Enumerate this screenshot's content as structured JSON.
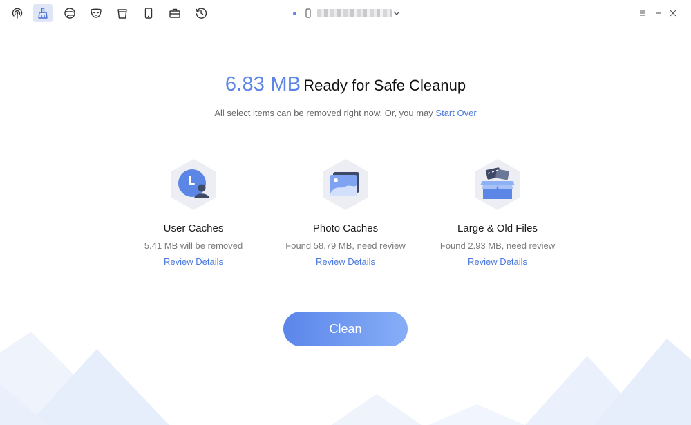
{
  "toolbar": {
    "tools": [
      {
        "icon": "airdrop-icon",
        "active": false
      },
      {
        "icon": "broom-icon",
        "active": true
      },
      {
        "icon": "browser-icon",
        "active": false
      },
      {
        "icon": "mask-icon",
        "active": false
      },
      {
        "icon": "trash-icon",
        "active": false
      },
      {
        "icon": "phone-icon",
        "active": false
      },
      {
        "icon": "toolbox-icon",
        "active": false
      },
      {
        "icon": "history-icon",
        "active": false
      }
    ],
    "device_icon": "phone-connected-icon"
  },
  "summary": {
    "size": "6.83 MB",
    "status": "Ready for Safe Cleanup",
    "subtitle": "All select items can be removed right now. Or, you may ",
    "start_over": "Start Over"
  },
  "categories": [
    {
      "icon": "user-caches-icon",
      "title": "User Caches",
      "description": "5.41 MB will be removed",
      "review": "Review Details"
    },
    {
      "icon": "photo-caches-icon",
      "title": "Photo Caches",
      "description": "Found 58.79 MB, need review",
      "review": "Review Details"
    },
    {
      "icon": "large-old-files-icon",
      "title": "Large & Old Files",
      "description": "Found 2.93 MB, need review",
      "review": "Review Details"
    }
  ],
  "clean_button": "Clean",
  "colors": {
    "accent": "#5b86e5",
    "link": "#4a78dd",
    "hex_bg": "#eceef3"
  }
}
